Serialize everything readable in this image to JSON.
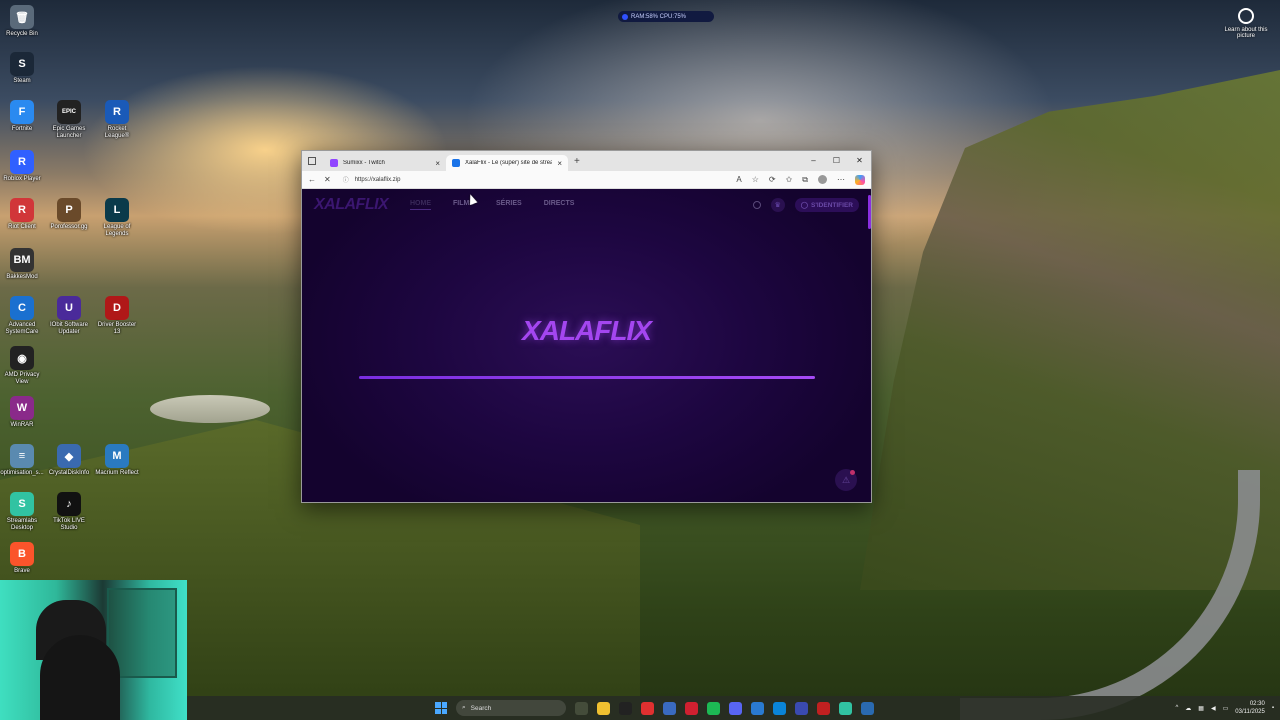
{
  "desktop": {
    "icons": [
      {
        "label": "Recycle Bin",
        "glyph": "🗑",
        "color": "#5a6a7a"
      },
      {
        "label": "Steam",
        "glyph": "S",
        "color": "#1b2838"
      },
      {
        "label": "Fortnite",
        "glyph": "F",
        "color": "#2a8af0"
      },
      {
        "label": "Epic Games Launcher",
        "glyph": "EPIC",
        "color": "#222222"
      },
      {
        "label": "Rocket League®",
        "glyph": "R",
        "color": "#1a5ab8"
      },
      {
        "label": "Roblox Player",
        "glyph": "R",
        "color": "#3060ff"
      },
      {
        "label": "Riot Client",
        "glyph": "R",
        "color": "#d13639"
      },
      {
        "label": "Porofessor.gg",
        "glyph": "P",
        "color": "#6a4a2a"
      },
      {
        "label": "League of Legends",
        "glyph": "L",
        "color": "#0a3a4a"
      },
      {
        "label": "BakkesMod",
        "glyph": "BM",
        "color": "#333333"
      },
      {
        "label": "Advanced SystemCare",
        "glyph": "C",
        "color": "#1a70d0"
      },
      {
        "label": "IObit Software Updater",
        "glyph": "U",
        "color": "#4a2a9a"
      },
      {
        "label": "Driver Booster 13",
        "glyph": "D",
        "color": "#b01818"
      },
      {
        "label": "AMD Privacy View",
        "glyph": "◉",
        "color": "#222222"
      },
      {
        "label": "WinRAR",
        "glyph": "W",
        "color": "#8a2a8a"
      },
      {
        "label": "optimisation_s...",
        "glyph": "≡",
        "color": "#5a8ab0"
      },
      {
        "label": "CrystalDiskInfo",
        "glyph": "◆",
        "color": "#3a6ab0"
      },
      {
        "label": "Macrium Reflect",
        "glyph": "M",
        "color": "#2a7ac0"
      },
      {
        "label": "Streamlabs Desktop",
        "glyph": "S",
        "color": "#31c3a2"
      },
      {
        "label": "TikTok LIVE Studio",
        "glyph": "♪",
        "color": "#111111"
      },
      {
        "label": "Brave",
        "glyph": "B",
        "color": "#fb542b"
      }
    ],
    "perf_widget": "RAM:58% CPU:75%",
    "learn_picture": "Learn about this picture"
  },
  "browser": {
    "tabs": [
      {
        "title": "Sumixx - Twitch",
        "fav_color": "#9146ff"
      },
      {
        "title": "XalaFlix - Le (super) site de stream",
        "fav_color": "#1a73e8"
      }
    ],
    "new_tab": "+",
    "url": "https://xalaflix.zip",
    "window_controls": [
      "–",
      "☐",
      "✕"
    ]
  },
  "site": {
    "logo": "XALAFLIX",
    "nav": [
      "HOME",
      "FILMS",
      "SÉRIES",
      "DIRECTS"
    ],
    "login": "S'IDENTIFIER",
    "splash_logo": "XALAFLIX",
    "progress": 1.0
  },
  "taskbar": {
    "search_placeholder": "Search",
    "apps": [
      "#444c3a",
      "#f0c030",
      "#222222",
      "#e03030",
      "#3a6ac0",
      "#d02030",
      "#1db954",
      "#5865f2",
      "#2a7ad0",
      "#0a84d8",
      "#3a4ab0",
      "#c02020",
      "#31c3a2",
      "#2a6ab0"
    ],
    "time": "02:30",
    "date": "03/11/2025"
  }
}
